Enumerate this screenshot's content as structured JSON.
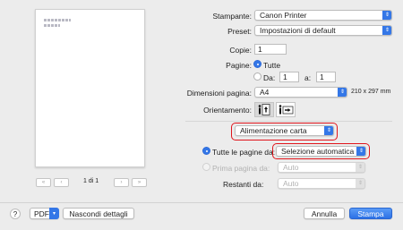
{
  "preview": {
    "page_indicator": "1 di 1",
    "first_label": "«",
    "prev_label": "‹",
    "next_label": "›",
    "last_label": "»"
  },
  "printer": {
    "label": "Stampante:",
    "value": "Canon Printer"
  },
  "preset": {
    "label": "Preset:",
    "value": "Impostazioni di default"
  },
  "copies": {
    "label": "Copie:",
    "value": "1"
  },
  "pages": {
    "label": "Pagine:",
    "all_label": "Tutte",
    "from_label": "Da:",
    "from_value": "1",
    "to_label": "a:",
    "to_value": "1"
  },
  "paper_size": {
    "label": "Dimensioni pagina:",
    "value": "A4",
    "dimensions": "210 x 297 mm"
  },
  "orientation": {
    "label": "Orientamento:"
  },
  "section": {
    "value": "Alimentazione carta"
  },
  "feed": {
    "all_pages_label": "Tutte le pagine da:",
    "all_pages_value": "Selezione automatica",
    "first_page_label": "Prima pagina da:",
    "first_page_value": "Auto",
    "remaining_label": "Restanti da:",
    "remaining_value": "Auto"
  },
  "footer": {
    "help_label": "?",
    "pdf_label": "PDF",
    "hide_details_label": "Nascondi dettagli",
    "cancel_label": "Annulla",
    "print_label": "Stampa"
  },
  "colors": {
    "accent": "#3477e7",
    "highlight": "#e0151c"
  },
  "icons": [
    "chevrons-updown-icon",
    "chevron-down-icon",
    "portrait-orientation-icon",
    "landscape-orientation-icon"
  ]
}
